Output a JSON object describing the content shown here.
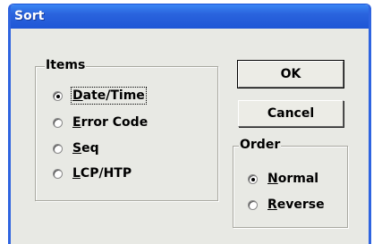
{
  "window": {
    "title": "Sort"
  },
  "items_group": {
    "legend": "Items",
    "options": [
      {
        "mnemonic": "D",
        "rest": "ate/Time",
        "checked": true
      },
      {
        "mnemonic": "E",
        "rest": "rror Code",
        "checked": false
      },
      {
        "mnemonic": "S",
        "rest": "eq",
        "checked": false
      },
      {
        "mnemonic": "L",
        "rest": "CP/HTP",
        "checked": false
      }
    ]
  },
  "buttons": {
    "ok": "OK",
    "cancel": "Cancel"
  },
  "order_group": {
    "legend": "Order",
    "options": [
      {
        "mnemonic": "N",
        "rest": "ormal",
        "checked": true
      },
      {
        "mnemonic": "R",
        "rest": "everse",
        "checked": false
      }
    ]
  },
  "colors": {
    "titlebar": "#2a63dd",
    "face": "#e8e9e4"
  }
}
